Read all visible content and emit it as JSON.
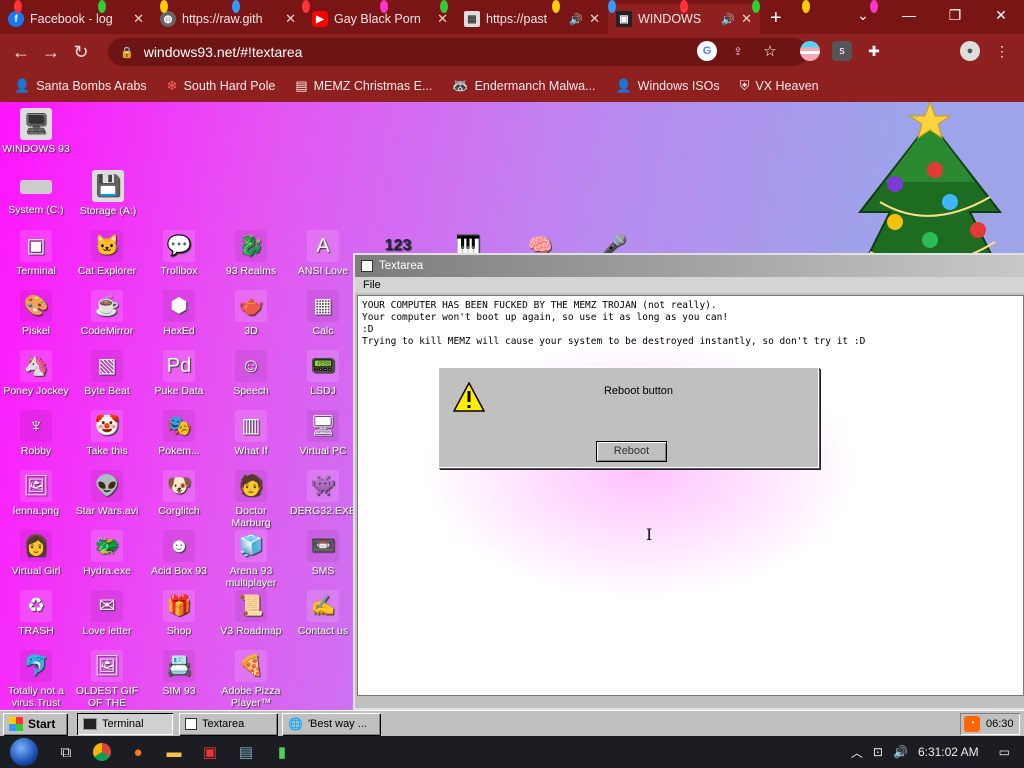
{
  "browser": {
    "tabs": [
      {
        "title": "Facebook - log",
        "icon": "facebook-icon",
        "color": "#1877f2",
        "glyph": "f"
      },
      {
        "title": "https://raw.gith",
        "icon": "globe-icon",
        "color": "#888888",
        "glyph": "◍"
      },
      {
        "title": "Gay Black Porn",
        "icon": "youtube-icon",
        "color": "#ff0000",
        "glyph": "▶"
      },
      {
        "title": "https://past",
        "icon": "pastebin-icon",
        "color": "#cccccc",
        "glyph": "▦"
      },
      {
        "title": "WINDOWS",
        "icon": "windows93-icon",
        "color": "#222222",
        "glyph": "▣",
        "active": true
      }
    ],
    "new_tab": "+",
    "url": "windows93.net/#!textarea",
    "bookmarks": [
      {
        "label": "Santa Bombs Arabs",
        "icon": "figure-icon"
      },
      {
        "label": "South Hard Pole",
        "icon": "snowflake-icon"
      },
      {
        "label": "MEMZ Christmas E...",
        "icon": "page-icon"
      },
      {
        "label": "Endermanch Malwa...",
        "icon": "raccoon-icon"
      },
      {
        "label": "Windows ISOs",
        "icon": "figure-icon"
      },
      {
        "label": "VX Heaven",
        "icon": "shield-icon"
      }
    ]
  },
  "desktop": {
    "top_icons": [
      {
        "label": "WINDOWS 93",
        "icon": "computer-icon"
      },
      {
        "label": "System (C:)",
        "icon": "drive-icon"
      },
      {
        "label": "Storage (A:)",
        "icon": "floppy-drive-icon"
      }
    ],
    "grid": [
      [
        "Terminal",
        "Cat Explorer",
        "Trollbox",
        "93 Realms",
        "ANSI Love"
      ],
      [
        "Piskel",
        "CodeMirror",
        "HexEd",
        "3D",
        "Calc"
      ],
      [
        "Poney Jockey",
        "Byte Beat",
        "Puke Data",
        "Speech",
        "LSDJ"
      ],
      [
        "Robby",
        "Take this",
        "Pokem...",
        "What If",
        "Virtual PC"
      ],
      [
        "lenna.png",
        "Star Wars.avi",
        "Corglitch",
        "Doctor Marburg",
        "DERG32.EXE"
      ],
      [
        "Virtual Girl",
        "Hydra.exe",
        "Acid Box 93",
        "Arena 93 multiplayer",
        "SMS"
      ],
      [
        "TRASH",
        "Love letter",
        "Shop",
        "V3 Roadmap",
        "Contact us"
      ],
      [
        "Totally not a virus.Trust",
        "OLDEST GIF OF THE",
        "SIM 93",
        "Adobe Pizza Player™",
        ""
      ]
    ]
  },
  "textarea_window": {
    "title": "Textarea",
    "menu": "File",
    "lines": [
      "YOUR COMPUTER HAS BEEN FUCKED BY THE MEMZ TROJAN (not really).",
      "Your computer won't boot up again, so use it as long as you can!",
      ":D",
      "Trying to kill MEMZ will cause your system to be destroyed instantly, so don't try it :D"
    ]
  },
  "dialog": {
    "message": "Reboot button",
    "button": "Reboot"
  },
  "w93_taskbar": {
    "start": "Start",
    "buttons": [
      "Terminal",
      "Textarea",
      "'Best way ..."
    ],
    "clock": "06:30"
  },
  "win_taskbar": {
    "time": "6:31:02 AM"
  },
  "colors": {
    "chrome_red": "#8f2020",
    "desktop_start": "#ff14ff",
    "desktop_end": "#a0a5e8"
  }
}
